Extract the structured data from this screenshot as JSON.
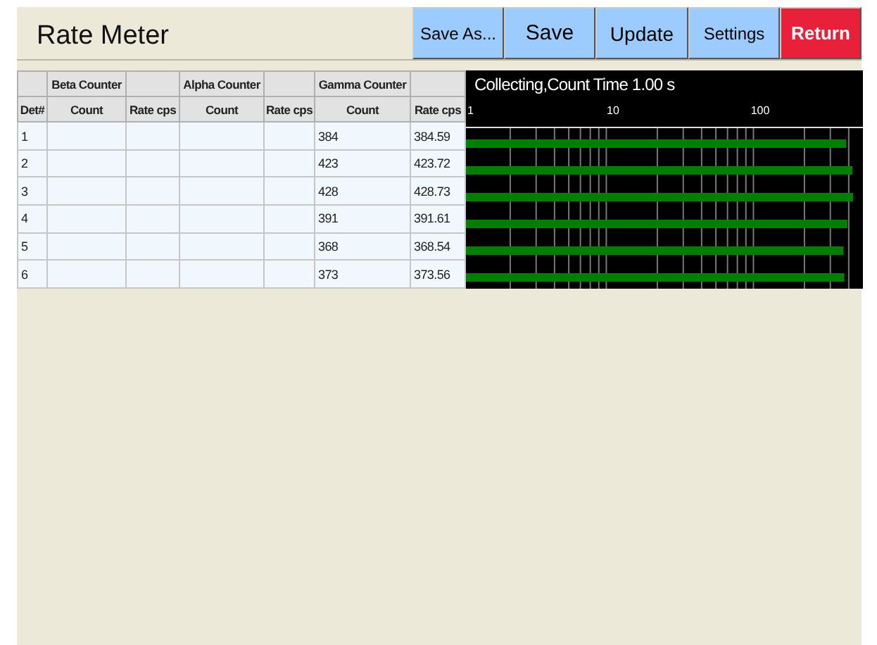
{
  "title": "Rate Meter",
  "buttons": [
    {
      "label": "Save As...",
      "kind": "normal"
    },
    {
      "label": "Save",
      "kind": "normal"
    },
    {
      "label": "Update",
      "kind": "normal"
    },
    {
      "label": "Settings",
      "kind": "normal"
    },
    {
      "label": "Return",
      "kind": "danger"
    }
  ],
  "table": {
    "columns": [
      {
        "label": "Det#"
      },
      {
        "label": "Count",
        "group": "Beta Counter"
      },
      {
        "label": "Rate cps"
      },
      {
        "label": "Count",
        "group": "Alpha Counter"
      },
      {
        "label": "Rate cps"
      },
      {
        "label": "Count",
        "group": "Gamma Counter"
      },
      {
        "label": "Rate cps"
      }
    ],
    "rows": [
      {
        "det": "1",
        "gamma_count": "384",
        "gamma_rate": "384.59"
      },
      {
        "det": "2",
        "gamma_count": "423",
        "gamma_rate": "423.72"
      },
      {
        "det": "3",
        "gamma_count": "428",
        "gamma_rate": "428.73"
      },
      {
        "det": "4",
        "gamma_count": "391",
        "gamma_rate": "391.61"
      },
      {
        "det": "5",
        "gamma_count": "368",
        "gamma_rate": "368.54"
      },
      {
        "det": "6",
        "gamma_count": "373",
        "gamma_rate": "373.56"
      }
    ]
  },
  "meter": {
    "title": "Collecting,Count Time 1.00 s",
    "scale_labels": [
      "1",
      "10",
      "100"
    ]
  }
}
